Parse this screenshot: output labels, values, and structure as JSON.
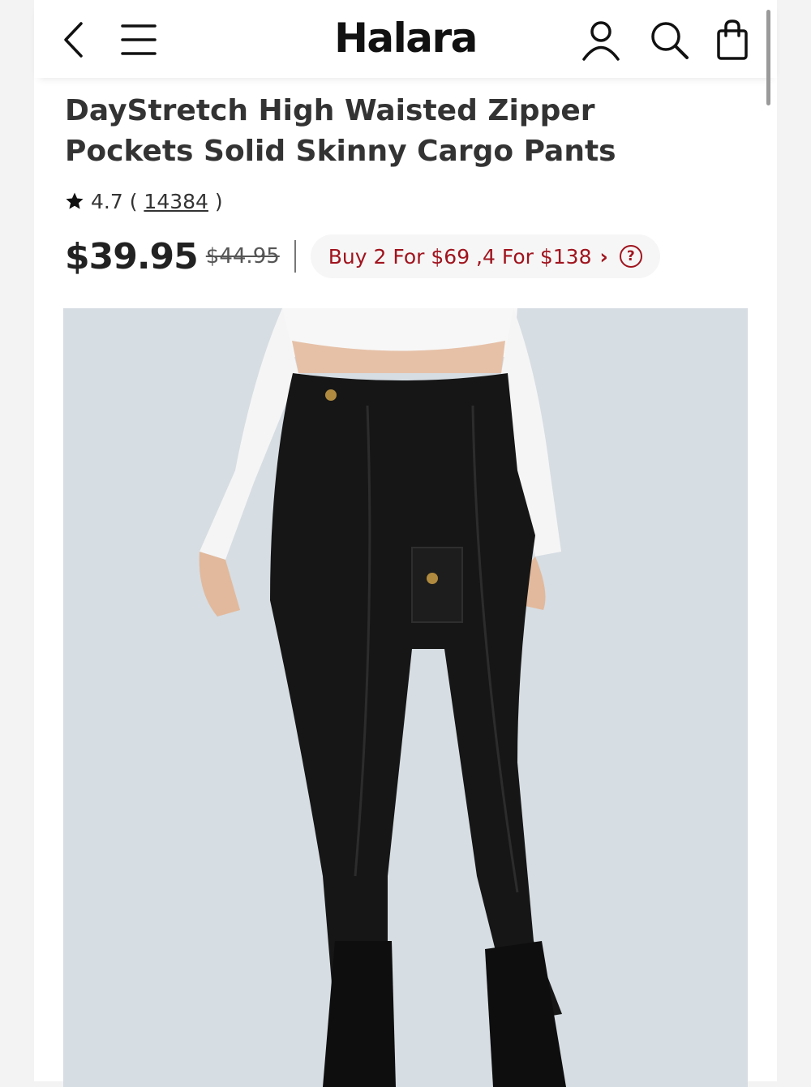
{
  "header": {
    "logo": "Halara",
    "icons": [
      "back-icon",
      "menu-icon",
      "account-icon",
      "search-icon",
      "cart-icon"
    ]
  },
  "product": {
    "title": "DayStretch High Waisted Zipper Pockets Solid Skinny Cargo Pants",
    "rating": "4.7",
    "review_count": "14384",
    "price": "$39.95",
    "original_price": "$44.95",
    "promo": "Buy 2 For $69 ,4 For $138"
  },
  "colors": {
    "accent": "#a0141e",
    "photo_background": "#d6dde3"
  }
}
